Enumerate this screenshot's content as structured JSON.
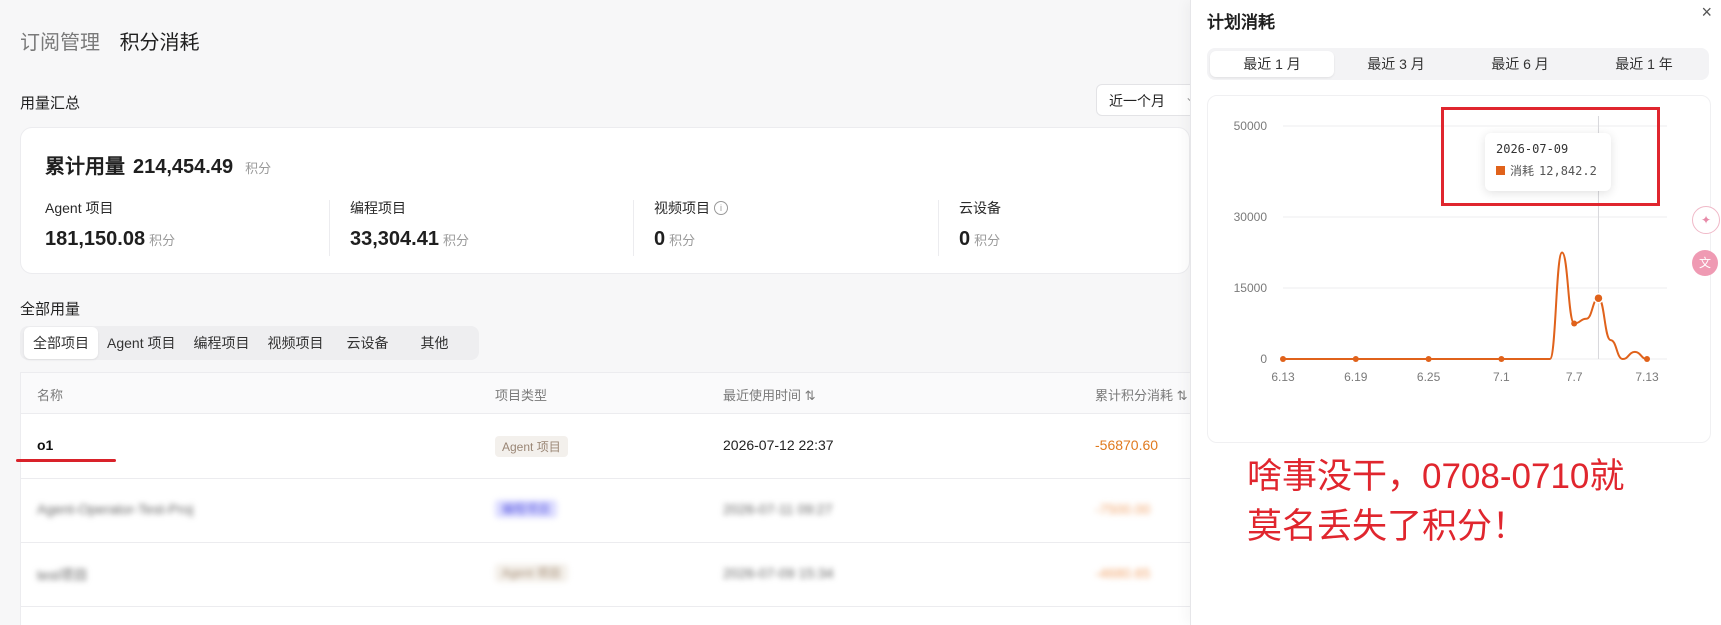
{
  "breadcrumb": {
    "parent": "订阅管理",
    "current": "积分消耗"
  },
  "usage_summary": {
    "title": "用量汇总",
    "range_select": "近一个月",
    "total_label": "累计用量",
    "total_value": "214,454.49",
    "unit": "积分",
    "metrics": [
      {
        "label": "Agent 项目",
        "value": "181,150.08",
        "unit": "积分"
      },
      {
        "label": "编程项目",
        "value": "33,304.41",
        "unit": "积分"
      },
      {
        "label": "视频项目",
        "value": "0",
        "unit": "积分"
      },
      {
        "label": "云设备",
        "value": "0",
        "unit": "积分"
      }
    ]
  },
  "all_usage": {
    "title": "全部用量",
    "tabs": [
      "全部项目",
      "Agent 项目",
      "编程项目",
      "视频项目",
      "云设备",
      "其他"
    ],
    "active_tab": 0
  },
  "table": {
    "columns": [
      "名称",
      "项目类型",
      "最近使用时间 ⇅",
      "累计积分消耗 ⇅"
    ],
    "rows": [
      {
        "name": "o1",
        "type": "Agent 项目",
        "time": "2026-07-12 22:37",
        "points": "-56870.60",
        "blurred": false
      },
      {
        "name": "Agent-Operator-Test-Proj",
        "type": "编程项目",
        "time": "2026-07-11 09:27",
        "points": "-7500.00",
        "blurred": true
      },
      {
        "name": "test项目",
        "type": "Agent 项目",
        "time": "2026-07-09 15:34",
        "points": "-4680.65",
        "blurred": true
      }
    ]
  },
  "panel": {
    "title": "计划消耗",
    "close": "×",
    "period_tabs": [
      "最近 1 月",
      "最近 3 月",
      "最近 6 月",
      "最近 1 年"
    ],
    "active_period": 0,
    "tooltip": {
      "date": "2026-07-09",
      "series": "消耗",
      "value": "12,842.2"
    },
    "annotation_line1": "啥事没干，0708-0710就",
    "annotation_line2": "莫名丢失了积分！"
  },
  "chart_data": {
    "type": "line",
    "series": [
      {
        "name": "消耗",
        "color": "#e0621b"
      }
    ],
    "x_ticks": [
      "6.13",
      "6.19",
      "6.25",
      "7.1",
      "7.7",
      "7.13"
    ],
    "y_ticks": [
      0,
      15000,
      30000,
      50000
    ],
    "ylim": [
      0,
      50000
    ],
    "points": [
      {
        "x": "6.13",
        "y": 0
      },
      {
        "x": "6.19",
        "y": 0
      },
      {
        "x": "6.25",
        "y": 0
      },
      {
        "x": "7.1",
        "y": 0
      },
      {
        "x": "7.5",
        "y": 0
      },
      {
        "x": "7.6",
        "y": 22500
      },
      {
        "x": "7.7",
        "y": 7500
      },
      {
        "x": "7.8",
        "y": 8500
      },
      {
        "x": "7.9",
        "y": 12842.2
      },
      {
        "x": "7.10",
        "y": 4000
      },
      {
        "x": "7.11",
        "y": 0
      },
      {
        "x": "7.12",
        "y": 1500
      },
      {
        "x": "7.13",
        "y": 0
      }
    ],
    "marked_x": [
      "6.13",
      "6.19",
      "6.25",
      "7.1",
      "7.7",
      "7.9",
      "7.13"
    ],
    "hover_x": "7.9"
  }
}
